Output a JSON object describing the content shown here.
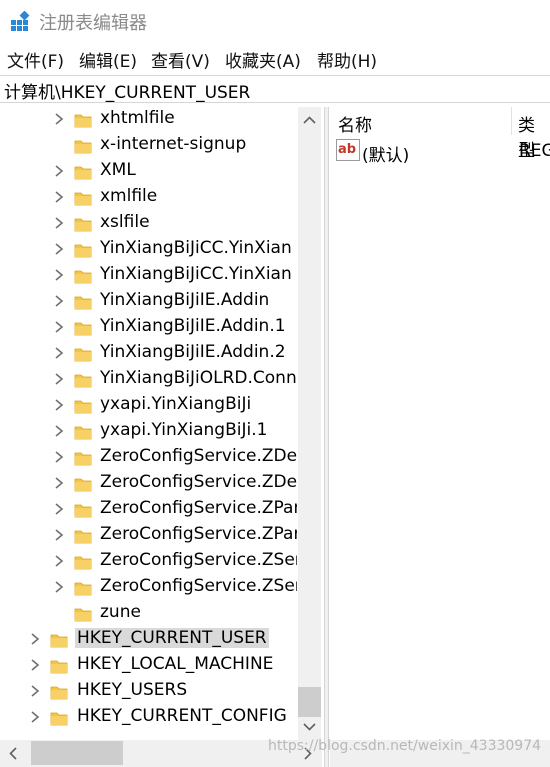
{
  "window": {
    "title": "注册表编辑器"
  },
  "menu": [
    {
      "label": "文件(F)"
    },
    {
      "label": "编辑(E)"
    },
    {
      "label": "查看(V)"
    },
    {
      "label": "收藏夹(A)"
    },
    {
      "label": "帮助(H)"
    }
  ],
  "address": {
    "path": "计算机\\HKEY_CURRENT_USER"
  },
  "tree": {
    "items": [
      {
        "label": "xhtmlfile",
        "expandable": true
      },
      {
        "label": "x-internet-signup",
        "expandable": false
      },
      {
        "label": "XML",
        "expandable": true
      },
      {
        "label": "xmlfile",
        "expandable": true
      },
      {
        "label": "xslfile",
        "expandable": true
      },
      {
        "label": "YinXiangBiJiCC.YinXian",
        "expandable": true
      },
      {
        "label": "YinXiangBiJiCC.YinXian",
        "expandable": true
      },
      {
        "label": "YinXiangBiJiIE.Addin",
        "expandable": true
      },
      {
        "label": "YinXiangBiJiIE.Addin.1",
        "expandable": true
      },
      {
        "label": "YinXiangBiJiIE.Addin.2",
        "expandable": true
      },
      {
        "label": "YinXiangBiJiOLRD.Conn",
        "expandable": true
      },
      {
        "label": "yxapi.YinXiangBiJi",
        "expandable": true
      },
      {
        "label": "yxapi.YinXiangBiJi.1",
        "expandable": true
      },
      {
        "label": "ZeroConfigService.ZDe",
        "expandable": true
      },
      {
        "label": "ZeroConfigService.ZDe",
        "expandable": true
      },
      {
        "label": "ZeroConfigService.ZPar",
        "expandable": true
      },
      {
        "label": "ZeroConfigService.ZPar",
        "expandable": true
      },
      {
        "label": "ZeroConfigService.ZSer",
        "expandable": true
      },
      {
        "label": "ZeroConfigService.ZSer",
        "expandable": true
      },
      {
        "label": "zune",
        "expandable": false
      }
    ],
    "roots": [
      {
        "label": "HKEY_CURRENT_USER",
        "selected": true
      },
      {
        "label": "HKEY_LOCAL_MACHINE",
        "selected": false
      },
      {
        "label": "HKEY_USERS",
        "selected": false
      },
      {
        "label": "HKEY_CURRENT_CONFIG",
        "selected": false
      }
    ]
  },
  "list": {
    "columns": {
      "name": "名称",
      "type": "类型"
    },
    "rows": [
      {
        "icon": "string-value-icon",
        "name": "(默认)",
        "type": "REG_SZ"
      }
    ]
  },
  "watermark": "https://blog.csdn.net/weixin_43330974",
  "colors": {
    "folder": "#f4c542",
    "selection": "#d9d9d9",
    "value_icon_red": "#c0392b",
    "scrollbar_track": "#f0f0f0"
  }
}
